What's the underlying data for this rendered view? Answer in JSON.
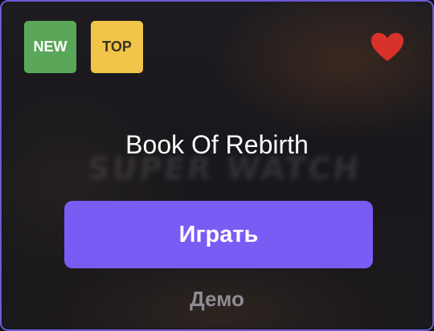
{
  "badges": {
    "new": {
      "label": "NEW",
      "color": "#5aa75a"
    },
    "top": {
      "label": "TOP",
      "color": "#f1c54a"
    }
  },
  "favorite": {
    "icon": "heart-icon",
    "color": "#d8322a"
  },
  "game": {
    "title": "Book Of Rebirth",
    "background_logo_text": "SUPER WATCH"
  },
  "actions": {
    "play_label": "Играть",
    "play_color": "#7a5cf5",
    "demo_label": "Демо"
  },
  "card": {
    "border_color": "#6b5bd6"
  }
}
